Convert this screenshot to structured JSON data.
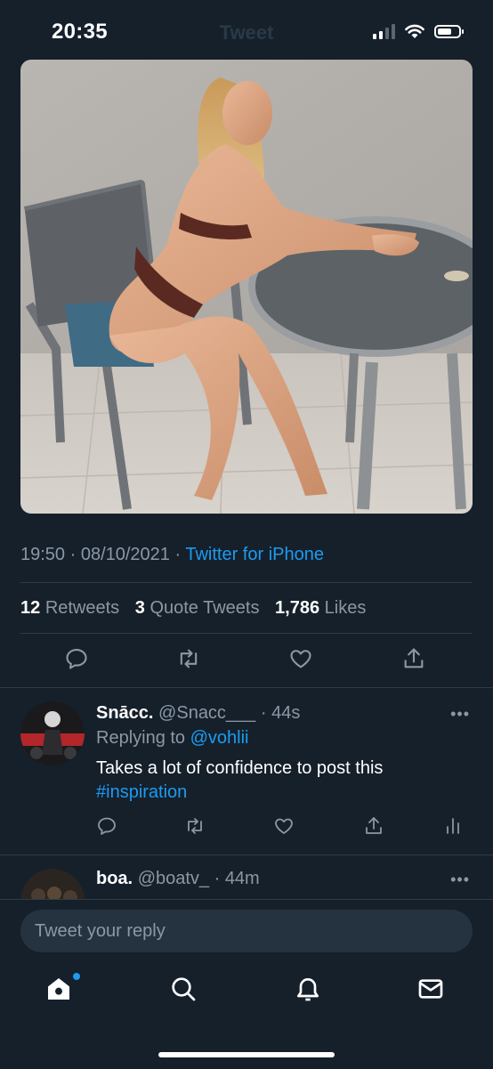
{
  "status_bar": {
    "time": "20:35",
    "ghost_title": "Tweet"
  },
  "tweet": {
    "timestamp": "19:50 · 08/10/2021 · ",
    "source": "Twitter for iPhone",
    "stats": {
      "retweets_count": "12",
      "retweets_label": "Retweets",
      "quotes_count": "3",
      "quotes_label": "Quote Tweets",
      "likes_count": "1,786",
      "likes_label": "Likes"
    }
  },
  "replies": [
    {
      "display_name": "Snācc.",
      "handle_time": "@Snacc___ · 44s",
      "replying_prefix": "Replying to ",
      "replying_to": "@vohlii",
      "text": "Takes a lot of confidence to post this",
      "hashtag": "#inspiration",
      "more": "•••"
    },
    {
      "display_name": "boa.",
      "handle_time": "@boatv_ · 44m",
      "more": "•••"
    }
  ],
  "composer": {
    "placeholder": "Tweet your reply"
  },
  "icons": {
    "reply": "reply-icon",
    "retweet": "retweet-icon",
    "like": "heart-icon",
    "share": "share-icon",
    "analytics": "analytics-icon",
    "home": "home-icon",
    "search": "search-icon",
    "notifications": "bell-icon",
    "messages": "mail-icon"
  },
  "colors": {
    "background": "#15202b",
    "accent": "#1d9bf0",
    "muted": "#8b98a5",
    "divider": "#2f3b47"
  }
}
